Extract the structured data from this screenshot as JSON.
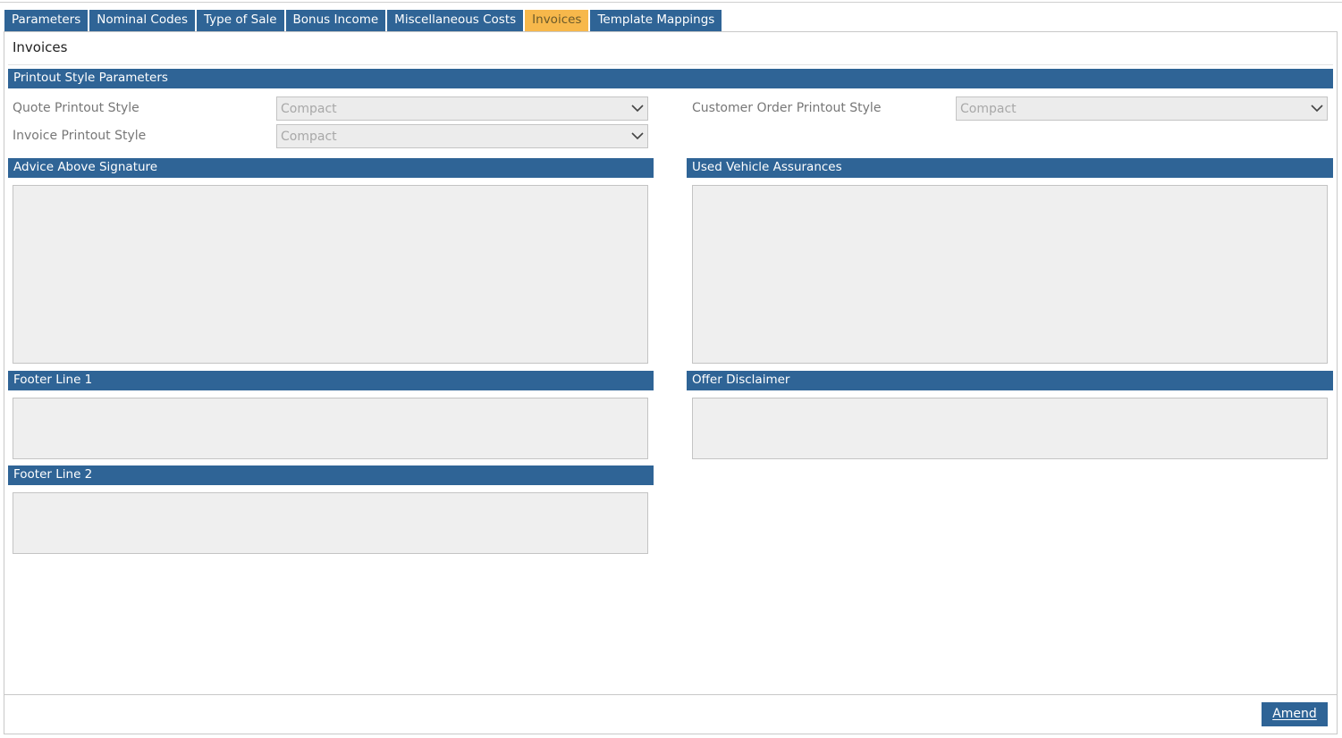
{
  "tabs": [
    {
      "label": "Parameters",
      "active": false
    },
    {
      "label": "Nominal Codes",
      "active": false
    },
    {
      "label": "Type of Sale",
      "active": false
    },
    {
      "label": "Bonus Income",
      "active": false
    },
    {
      "label": "Miscellaneous Costs",
      "active": false
    },
    {
      "label": "Invoices",
      "active": true
    },
    {
      "label": "Template Mappings",
      "active": false
    }
  ],
  "page": {
    "title": "Invoices"
  },
  "printout": {
    "section_title": "Printout Style Parameters",
    "quote_label": "Quote Printout Style",
    "quote_value": "Compact",
    "invoice_label": "Invoice Printout Style",
    "invoice_value": "Compact",
    "customer_order_label": "Customer Order Printout Style",
    "customer_order_value": "Compact"
  },
  "sections": {
    "advice_above_signature": "Advice Above Signature",
    "used_vehicle_assurances": "Used Vehicle Assurances",
    "footer_line_1": "Footer Line 1",
    "offer_disclaimer": "Offer Disclaimer",
    "footer_line_2": "Footer Line 2"
  },
  "fields": {
    "advice_above_signature": "",
    "used_vehicle_assurances": "",
    "footer_line_1": "",
    "offer_disclaimer": "",
    "footer_line_2": ""
  },
  "actions": {
    "amend_label": "Amend"
  },
  "colors": {
    "header_blue": "#2f6496",
    "active_tab": "#f7b84b",
    "field_bg": "#efefef"
  }
}
